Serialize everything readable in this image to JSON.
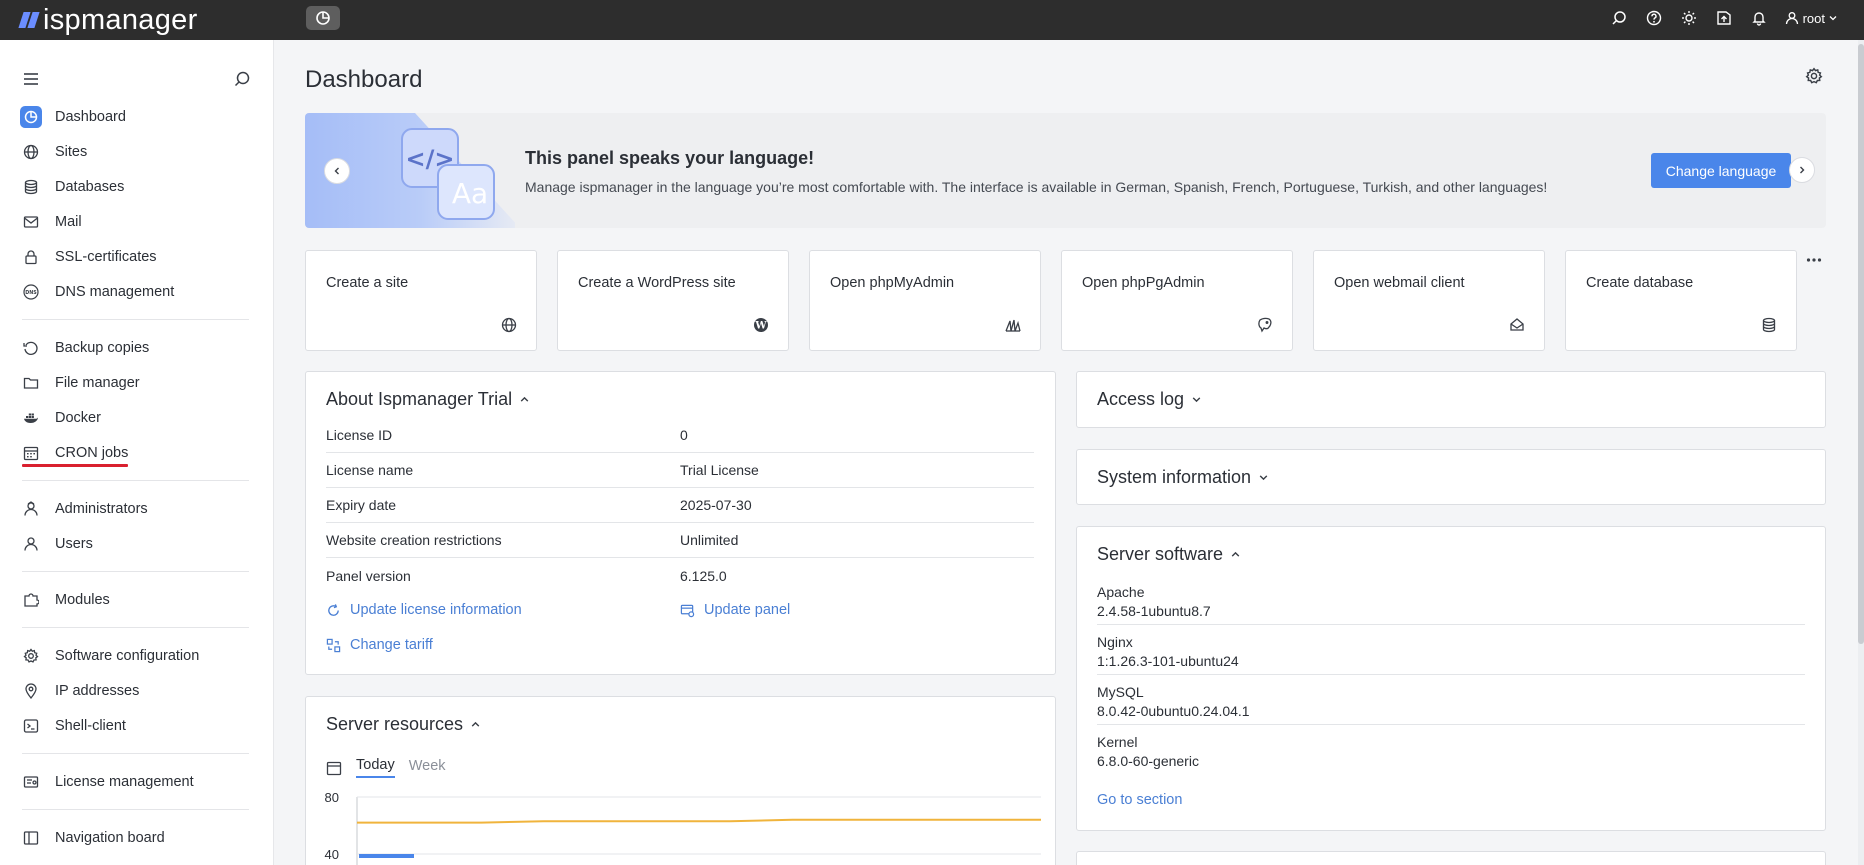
{
  "app": {
    "logo_text": "ispmanager",
    "user": "root"
  },
  "colors": {
    "accent": "#4a86ea",
    "topbar": "#2d2d2d",
    "link": "#4a7fd4",
    "underline": "#d9202f",
    "chart_line": "#f0b43c",
    "chart_bar": "#4a86ea"
  },
  "sidebar": {
    "items": [
      {
        "label": "Dashboard",
        "icon": "dashboard-icon"
      },
      {
        "label": "Sites",
        "icon": "globe-icon"
      },
      {
        "label": "Databases",
        "icon": "database-icon"
      },
      {
        "label": "Mail",
        "icon": "mail-icon"
      },
      {
        "label": "SSL-certificates",
        "icon": "lock-icon"
      },
      {
        "label": "DNS management",
        "icon": "dns-icon"
      },
      {
        "label": "Backup copies",
        "icon": "backup-icon"
      },
      {
        "label": "File manager",
        "icon": "folder-icon"
      },
      {
        "label": "Docker",
        "icon": "docker-icon"
      },
      {
        "label": "CRON jobs",
        "icon": "calendar-icon"
      },
      {
        "label": "Administrators",
        "icon": "admin-icon"
      },
      {
        "label": "Users",
        "icon": "user-icon"
      },
      {
        "label": "Modules",
        "icon": "modules-icon"
      },
      {
        "label": "Software configuration",
        "icon": "settings-icon"
      },
      {
        "label": "IP addresses",
        "icon": "location-icon"
      },
      {
        "label": "Shell-client",
        "icon": "terminal-icon"
      },
      {
        "label": "License management",
        "icon": "license-icon"
      },
      {
        "label": "Navigation board",
        "icon": "board-icon"
      }
    ]
  },
  "main": {
    "title": "Dashboard",
    "banner": {
      "title": "This panel speaks your language!",
      "text": "Manage ispmanager in the language you’re most comfortable with. The interface is available in German, Spanish, French, Portuguese, Turkish, and other languages!",
      "button": "Change language",
      "art_code": "</>",
      "art_text": "Aa"
    },
    "tiles": [
      {
        "label": "Create a site",
        "icon": "globe-icon"
      },
      {
        "label": "Create a WordPress site",
        "icon": "wordpress-icon"
      },
      {
        "label": "Open phpMyAdmin",
        "icon": "phpmyadmin-icon"
      },
      {
        "label": "Open phpPgAdmin",
        "icon": "postgresql-icon"
      },
      {
        "label": "Open webmail client",
        "icon": "webmail-icon"
      },
      {
        "label": "Create database",
        "icon": "database-icon"
      }
    ],
    "about": {
      "title": "About Ispmanager Trial",
      "rows": [
        {
          "key": "License ID",
          "value": "0"
        },
        {
          "key": "License name",
          "value": "Trial License"
        },
        {
          "key": "Expiry date",
          "value": "2025-07-30"
        },
        {
          "key": "Website creation restrictions",
          "value": "Unlimited"
        },
        {
          "key": "Panel version",
          "value": "6.125.0"
        }
      ],
      "update_license": "Update license information",
      "update_panel": "Update panel",
      "change_tariff": "Change tariff"
    },
    "resources": {
      "title": "Server resources",
      "tabs": [
        "Today",
        "Week"
      ],
      "y_ticks": [
        "80",
        "40"
      ]
    },
    "access_log": {
      "title": "Access log"
    },
    "system_info": {
      "title": "System information"
    },
    "software": {
      "title": "Server software",
      "items": [
        {
          "name": "Apache",
          "version": "2.4.58-1ubuntu8.7"
        },
        {
          "name": "Nginx",
          "version": "1:1.26.3-101-ubuntu24"
        },
        {
          "name": "MySQL",
          "version": "8.0.42-0ubuntu0.24.04.1"
        },
        {
          "name": "Kernel",
          "version": "6.8.0-60-generic"
        }
      ],
      "go": "Go to section"
    }
  },
  "chart_data": {
    "type": "line",
    "title": "",
    "y_ticks": [
      80,
      40
    ],
    "series": [
      {
        "values": [
          62,
          62,
          62,
          63,
          63,
          63,
          63,
          64,
          64,
          64,
          64,
          64
        ]
      }
    ]
  }
}
